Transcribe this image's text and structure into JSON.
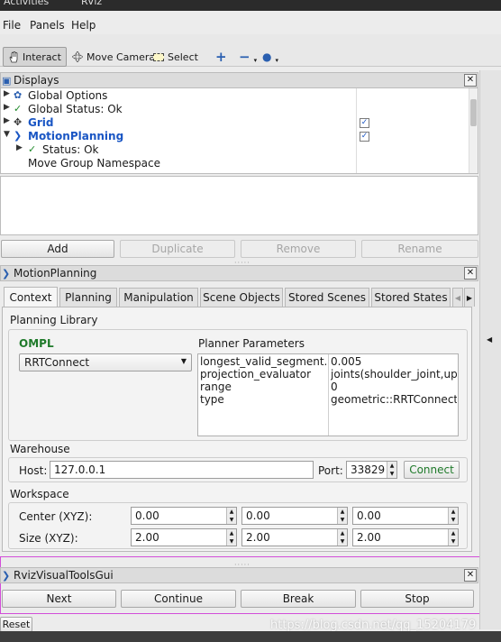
{
  "window": {
    "top_text": "Activities",
    "title": "RViz"
  },
  "menu": {
    "file": "File",
    "panels": "Panels",
    "help": "Help"
  },
  "toolbar": {
    "interact": "Interact",
    "move_camera": "Move Camera",
    "select": "Select"
  },
  "displays_panel": {
    "title": "Displays",
    "items": [
      {
        "label": "Global Options",
        "icon": "gear-icon"
      },
      {
        "label": "Global Status: Ok",
        "icon": "check-icon"
      },
      {
        "label": "Grid",
        "icon": "grid-icon",
        "checked": true
      },
      {
        "label": "MotionPlanning",
        "icon": "motion-planning-icon",
        "checked": true
      },
      {
        "label": "Status: Ok",
        "icon": "check-icon"
      },
      {
        "label": "Move Group Namespace"
      }
    ],
    "buttons": {
      "add": "Add",
      "duplicate": "Duplicate",
      "remove": "Remove",
      "rename": "Rename"
    }
  },
  "motion_planning": {
    "title": "MotionPlanning",
    "tabs": [
      "Context",
      "Planning",
      "Manipulation",
      "Scene Objects",
      "Stored Scenes",
      "Stored States"
    ],
    "active_tab": "Context",
    "planning_library_label": "Planning Library",
    "library": "OMPL",
    "planner": "RRTConnect",
    "planner_params_label": "Planner Parameters",
    "params": [
      {
        "name": "longest_valid_segment...",
        "value": "0.005"
      },
      {
        "name": "projection_evaluator",
        "value": "joints(shoulder_joint,up..."
      },
      {
        "name": "range",
        "value": "0"
      },
      {
        "name": "type",
        "value": "geometric::RRTConnect"
      }
    ],
    "warehouse_label": "Warehouse",
    "host_label": "Host:",
    "host": "127.0.0.1",
    "port_label": "Port:",
    "port": "33829",
    "connect": "Connect",
    "workspace_label": "Workspace",
    "center_label": "Center (XYZ):",
    "center": [
      "0.00",
      "0.00",
      "0.00"
    ],
    "size_label": "Size (XYZ):",
    "size": [
      "2.00",
      "2.00",
      "2.00"
    ]
  },
  "rviz_visual_tools": {
    "title": "RvizVisualToolsGui",
    "buttons": {
      "next": "Next",
      "continue": "Continue",
      "break": "Break",
      "stop": "Stop"
    }
  },
  "reset": "Reset",
  "watermark": "https://blog.csdn.net/qq_15204179",
  "colors": {
    "accent_blue": "#1a56c4",
    "check_green": "#1f8a2a",
    "highlight_border": "#d24ed9",
    "connect_green": "#1f7a2a"
  }
}
